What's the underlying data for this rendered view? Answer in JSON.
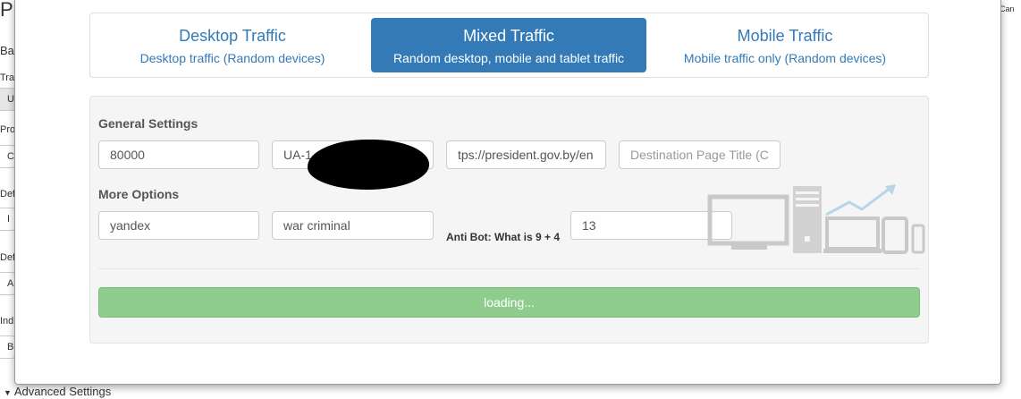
{
  "background": {
    "title_fragment": "Pr",
    "fragments": [
      "Ba",
      "Tra",
      "UA",
      "Pro",
      "C",
      "Def",
      "I",
      "Def",
      "A",
      "Ind",
      "Bo"
    ],
    "right_fragment": "Can",
    "advanced_settings": "Advanced Settings"
  },
  "tabs": [
    {
      "title": "Desktop Traffic",
      "subtitle": "Desktop traffic (Random devices)",
      "active": false
    },
    {
      "title": "Mixed Traffic",
      "subtitle": "Random desktop, mobile and tablet traffic",
      "active": true
    },
    {
      "title": "Mobile Traffic",
      "subtitle": "Mobile traffic only (Random devices)",
      "active": false
    }
  ],
  "general_settings": {
    "label": "General Settings",
    "visits": "80000",
    "tracking_id": "UA-1",
    "destination_url": "tps://president.gov.by/en",
    "destination_title_placeholder": "Destination Page Title (C"
  },
  "more_options": {
    "label": "More Options",
    "search_engine": "yandex",
    "keyword": "war criminal",
    "anti_bot_label": "Anti Bot: What is 9 + 4",
    "anti_bot_answer": "13"
  },
  "submit": {
    "label": "loading..."
  },
  "colors": {
    "primary": "#337ab7",
    "success_disabled": "#8fcd8f"
  },
  "icons": {
    "devices": "devices-traffic-icon"
  }
}
